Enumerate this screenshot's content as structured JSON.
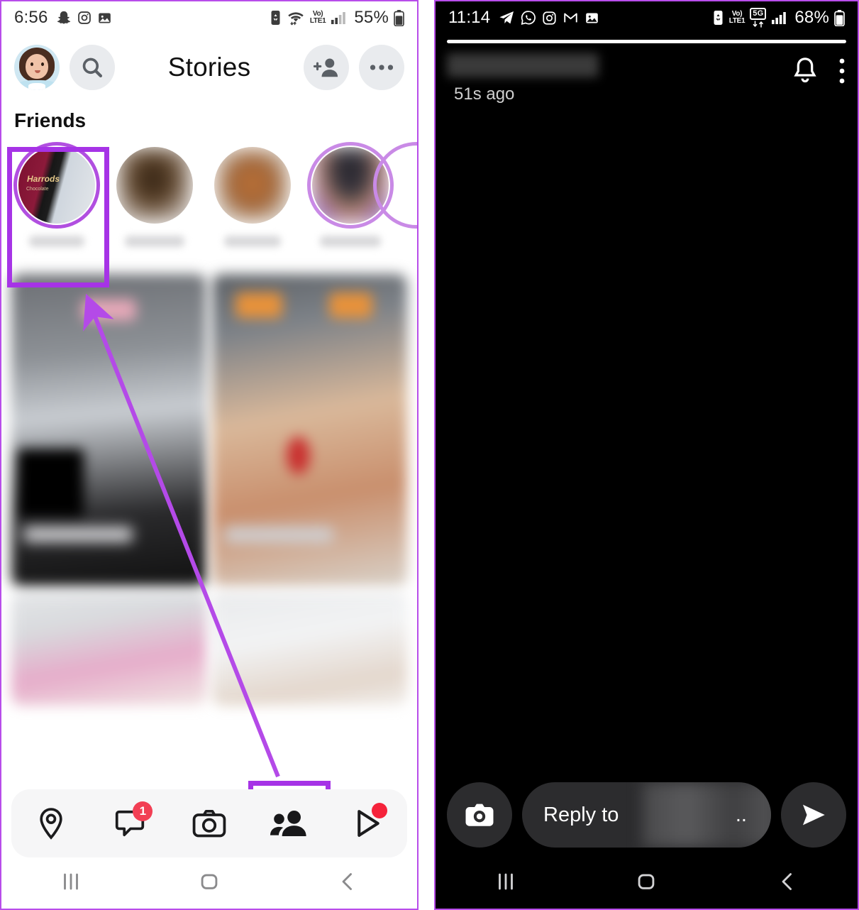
{
  "left_panel": {
    "status_bar": {
      "time": "6:56",
      "battery_percent": "55%",
      "network_label": "Vo)",
      "network_sub": "LTE1",
      "app_icons": [
        "snapchat-ghost-icon",
        "instagram-icon",
        "photos-icon"
      ],
      "right_icons": [
        "recycle-battery-icon",
        "wifi-icon",
        "volte-icon",
        "signal-bars-icon",
        "battery-icon"
      ]
    },
    "header": {
      "title": "Stories",
      "avatar": "bitmoji-avatar",
      "search_icon": "search-icon",
      "add_friend_icon": "add-friend-icon",
      "more_icon": "more-options-icon"
    },
    "friends_section": {
      "title": "Friends",
      "stories": [
        {
          "name": "",
          "highlighted": true,
          "has_ring": true
        },
        {
          "name": "",
          "highlighted": false,
          "has_ring": false
        },
        {
          "name": "",
          "highlighted": false,
          "has_ring": false
        },
        {
          "name": "",
          "highlighted": false,
          "has_ring": true
        }
      ]
    },
    "recent_section": {
      "title": ""
    },
    "bottom_nav": [
      {
        "icon": "map-pin-icon",
        "label": "Map",
        "badge": ""
      },
      {
        "icon": "chat-icon",
        "label": "Chat",
        "badge": "1"
      },
      {
        "icon": "camera-icon",
        "label": "Camera",
        "badge": ""
      },
      {
        "icon": "friends-icon",
        "label": "Friends",
        "badge": "",
        "selected": true
      },
      {
        "icon": "spotlight-play-icon",
        "label": "Spotlight",
        "badge": "dot"
      }
    ],
    "system_nav": [
      "recents-icon",
      "home-icon",
      "back-icon"
    ]
  },
  "right_panel": {
    "status_bar": {
      "time": "11:14",
      "battery_percent": "68%",
      "network_label": "Vo)",
      "network_sub": "LTE1",
      "network_gen": "5G",
      "app_icons": [
        "telegram-icon",
        "whatsapp-icon",
        "instagram-icon",
        "gmail-icon",
        "photos-icon"
      ],
      "right_icons": [
        "recycle-battery-icon",
        "volte-icon",
        "5g-icon",
        "signal-bars-icon",
        "battery-icon"
      ]
    },
    "story_header": {
      "username": "",
      "timestamp": "51s ago",
      "bell_icon": "bell-notification-icon",
      "menu_icon": "more-vertical-icon"
    },
    "reply_bar": {
      "camera_icon": "camera-icon",
      "reply_prefix": "Reply to",
      "reply_suffix": "..",
      "send_icon": "send-icon"
    },
    "system_nav": [
      "recents-icon",
      "home-icon",
      "back-icon"
    ]
  },
  "annotations": {
    "highlight_color": "#a633e6",
    "boxes": [
      "story-thumbnail-highlight",
      "friends-nav-highlight",
      "timestamp-highlight"
    ],
    "arrow": "pointer-arrow-from-nav-to-story"
  }
}
